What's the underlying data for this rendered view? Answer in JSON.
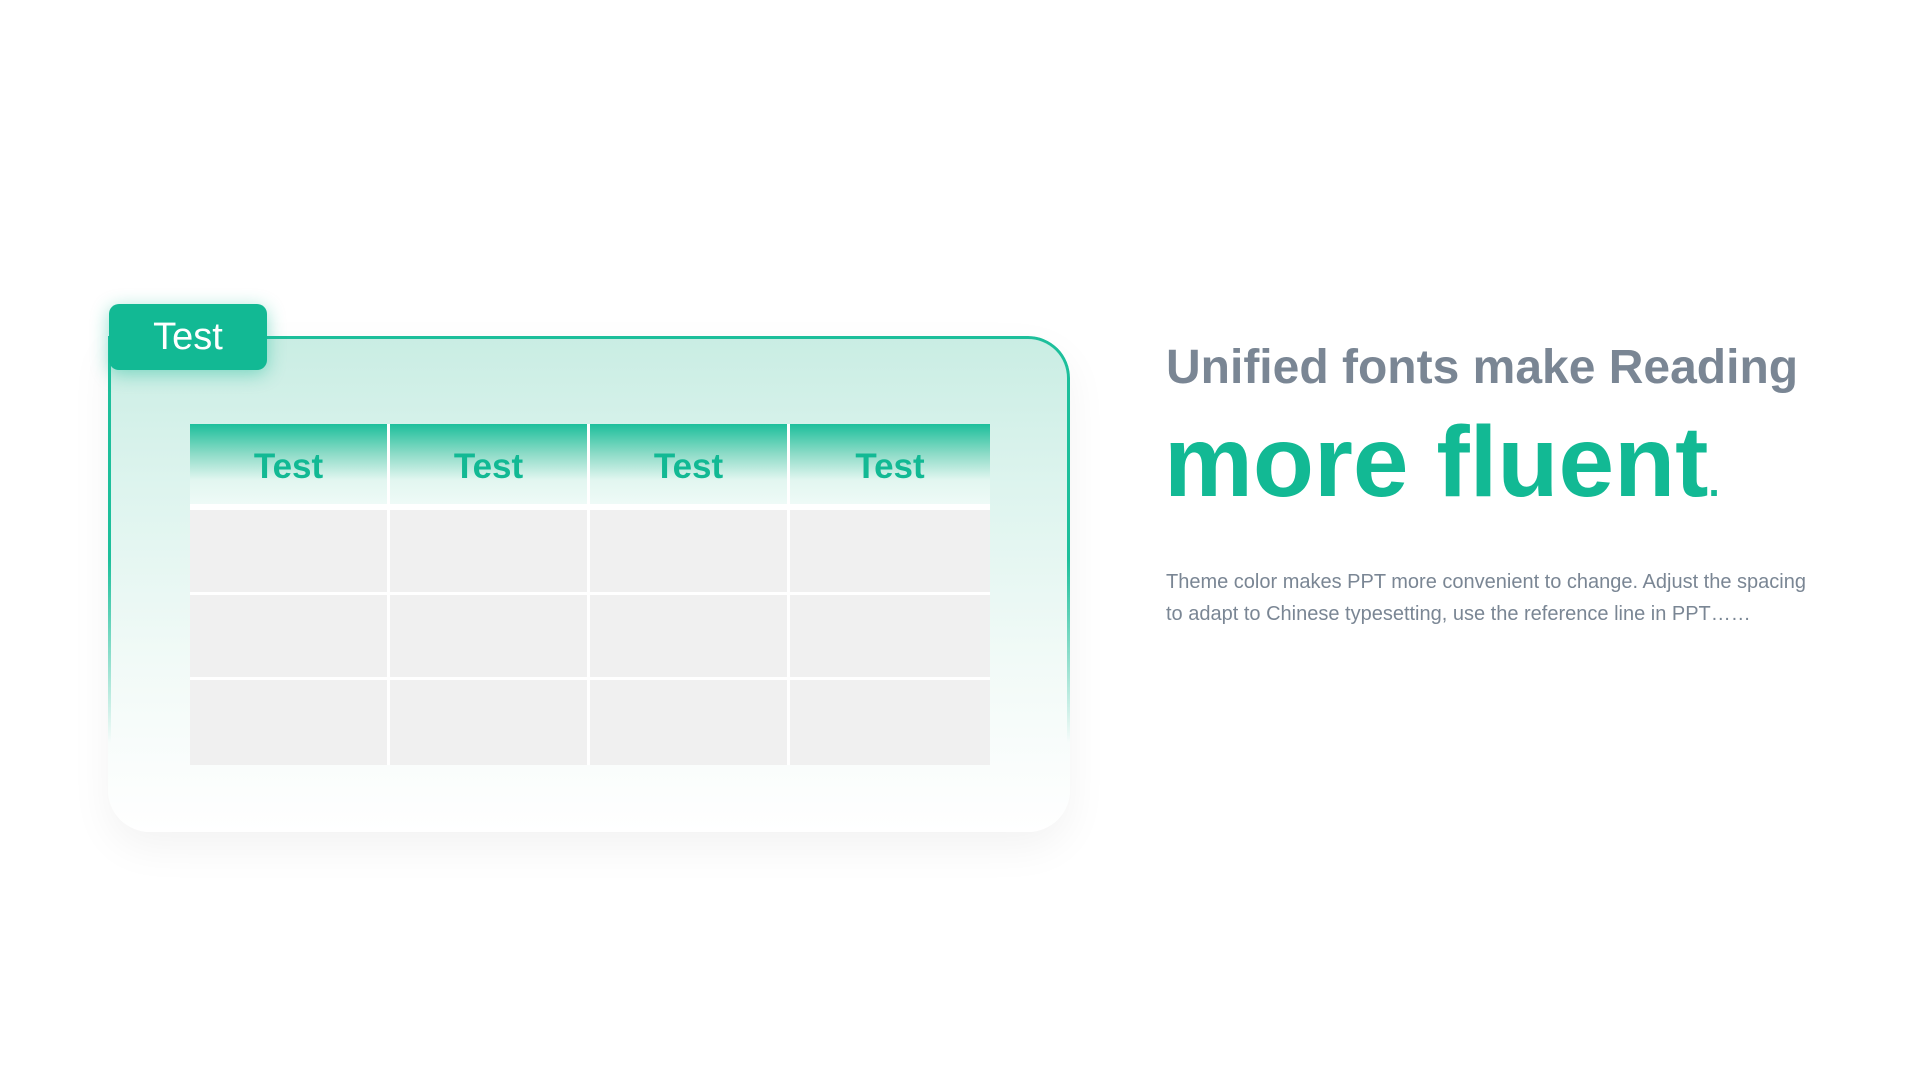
{
  "card": {
    "tab_label": "Test"
  },
  "table": {
    "headers": [
      "Test",
      "Test",
      "Test",
      "Test"
    ],
    "rows": [
      [
        "",
        "",
        "",
        ""
      ],
      [
        "",
        "",
        "",
        ""
      ],
      [
        "",
        "",
        "",
        ""
      ]
    ]
  },
  "text": {
    "heading": "Unified fonts make Reading",
    "title_main": "more fluent",
    "title_dot": ".",
    "body": "Theme color makes PPT more convenient to change. Adjust the spacing to adapt to Chinese typesetting, use the reference line in PPT……"
  },
  "colors": {
    "accent": "#12b994",
    "text_gray": "#7a8694",
    "cell_gray": "#f0f0f0"
  }
}
